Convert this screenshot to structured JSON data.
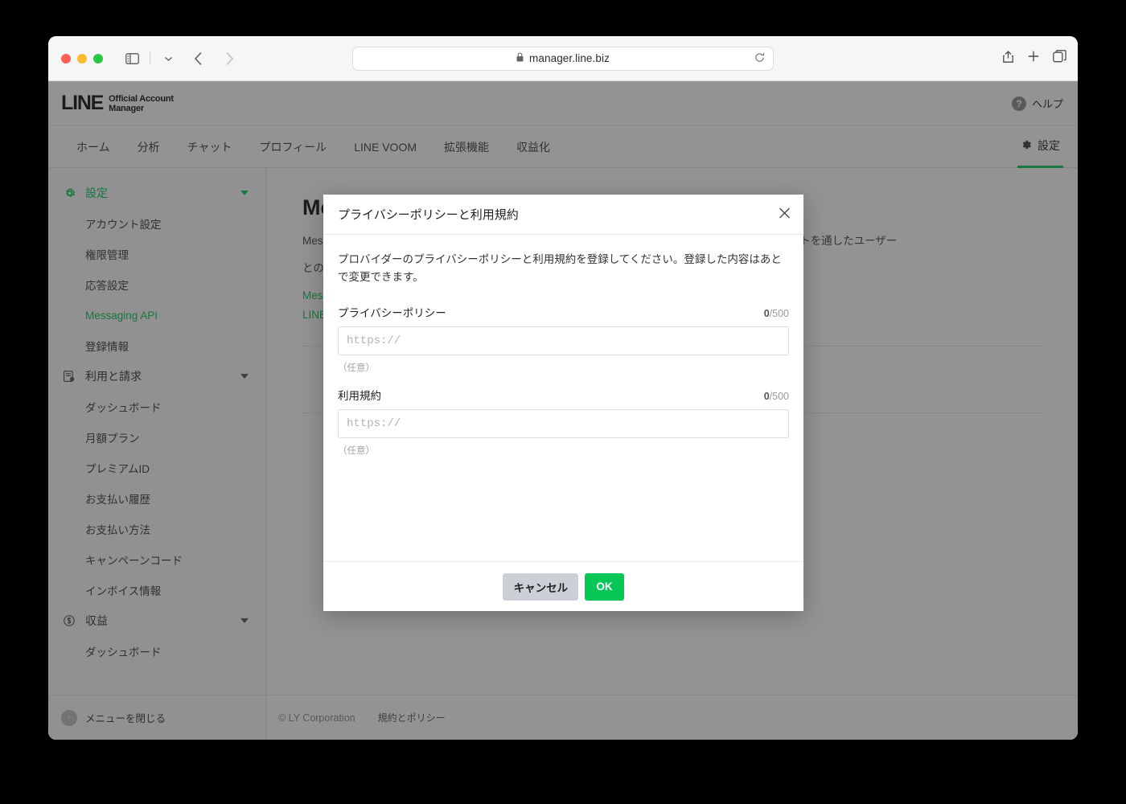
{
  "browser": {
    "url": "manager.line.biz",
    "lock_icon": "lock-icon",
    "reload_icon": "reload-icon",
    "sidebar_toggle_icon": "sidebar-toggle-icon",
    "tab_overview_chevron_icon": "chevron-down-icon",
    "back_icon": "chevron-left-icon",
    "forward_icon": "chevron-right-icon",
    "share_icon": "share-icon",
    "new_tab_icon": "plus-icon",
    "tabs_icon": "tabs-icon"
  },
  "header": {
    "logo_main": "LINE",
    "logo_sub_line1": "Official Account",
    "logo_sub_line2": "Manager",
    "help_icon": "question-mark-icon",
    "help_label": "ヘルプ"
  },
  "nav": {
    "items": [
      {
        "label": "ホーム"
      },
      {
        "label": "分析"
      },
      {
        "label": "チャット"
      },
      {
        "label": "プロフィール"
      },
      {
        "label": "LINE VOOM"
      },
      {
        "label": "拡張機能"
      },
      {
        "label": "収益化"
      }
    ],
    "settings_label": "設定",
    "settings_icon": "gear-icon",
    "active_accent": "#06c755"
  },
  "sidebar": {
    "groups": [
      {
        "label": "設定",
        "icon": "gear-icon",
        "active": true,
        "caret": "caret-down-icon",
        "items": [
          {
            "label": "アカウント設定",
            "active": false
          },
          {
            "label": "権限管理",
            "active": false
          },
          {
            "label": "応答設定",
            "active": false
          },
          {
            "label": "Messaging API",
            "active": true
          },
          {
            "label": "登録情報",
            "active": false
          }
        ]
      },
      {
        "label": "利用と請求",
        "icon": "receipt-icon",
        "active": false,
        "caret": "caret-down-icon",
        "items": [
          {
            "label": "ダッシュボード",
            "active": false
          },
          {
            "label": "月額プラン",
            "active": false
          },
          {
            "label": "プレミアムID",
            "active": false
          },
          {
            "label": "お支払い履歴",
            "active": false
          },
          {
            "label": "お支払い方法",
            "active": false
          },
          {
            "label": "キャンペーンコード",
            "active": false
          },
          {
            "label": "インボイス情報",
            "active": false
          }
        ]
      },
      {
        "label": "収益",
        "icon": "dollar-circle-icon",
        "active": false,
        "caret": "caret-down-icon",
        "items": [
          {
            "label": "ダッシュボード",
            "active": false
          }
        ]
      }
    ],
    "collapse_label": "メニューを閉じる",
    "collapse_icon": "chevron-left-circle-icon"
  },
  "main": {
    "title": "Messaging API",
    "desc_line1": "Messaging APIを利用すると、ユーザーとの双方向のコミュニケーションができるため、LINEアカウントを通したユーザー",
    "desc_line2": "との関係構築に役立ちます。",
    "link1": "Messaging APIの詳細はこちら",
    "link2": "LINE Developersでの開発について",
    "footer_copyright": "© LY Corporation",
    "footer_policy": "規約とポリシー"
  },
  "modal": {
    "title": "プライバシーポリシーと利用規約",
    "close_icon": "close-icon",
    "description": "プロバイダーのプライバシーポリシーと利用規約を登録してください。登録した内容はあとで変更できます。",
    "fields": [
      {
        "label": "プライバシーポリシー",
        "count_current": "0",
        "count_max": "/500",
        "value": "",
        "placeholder": "https://",
        "hint": "（任意）"
      },
      {
        "label": "利用規約",
        "count_current": "0",
        "count_max": "/500",
        "value": "",
        "placeholder": "https://",
        "hint": "（任意）"
      }
    ],
    "cancel_label": "キャンセル",
    "ok_label": "OK",
    "ok_color": "#06c755",
    "cancel_color": "#ccd0d6"
  }
}
